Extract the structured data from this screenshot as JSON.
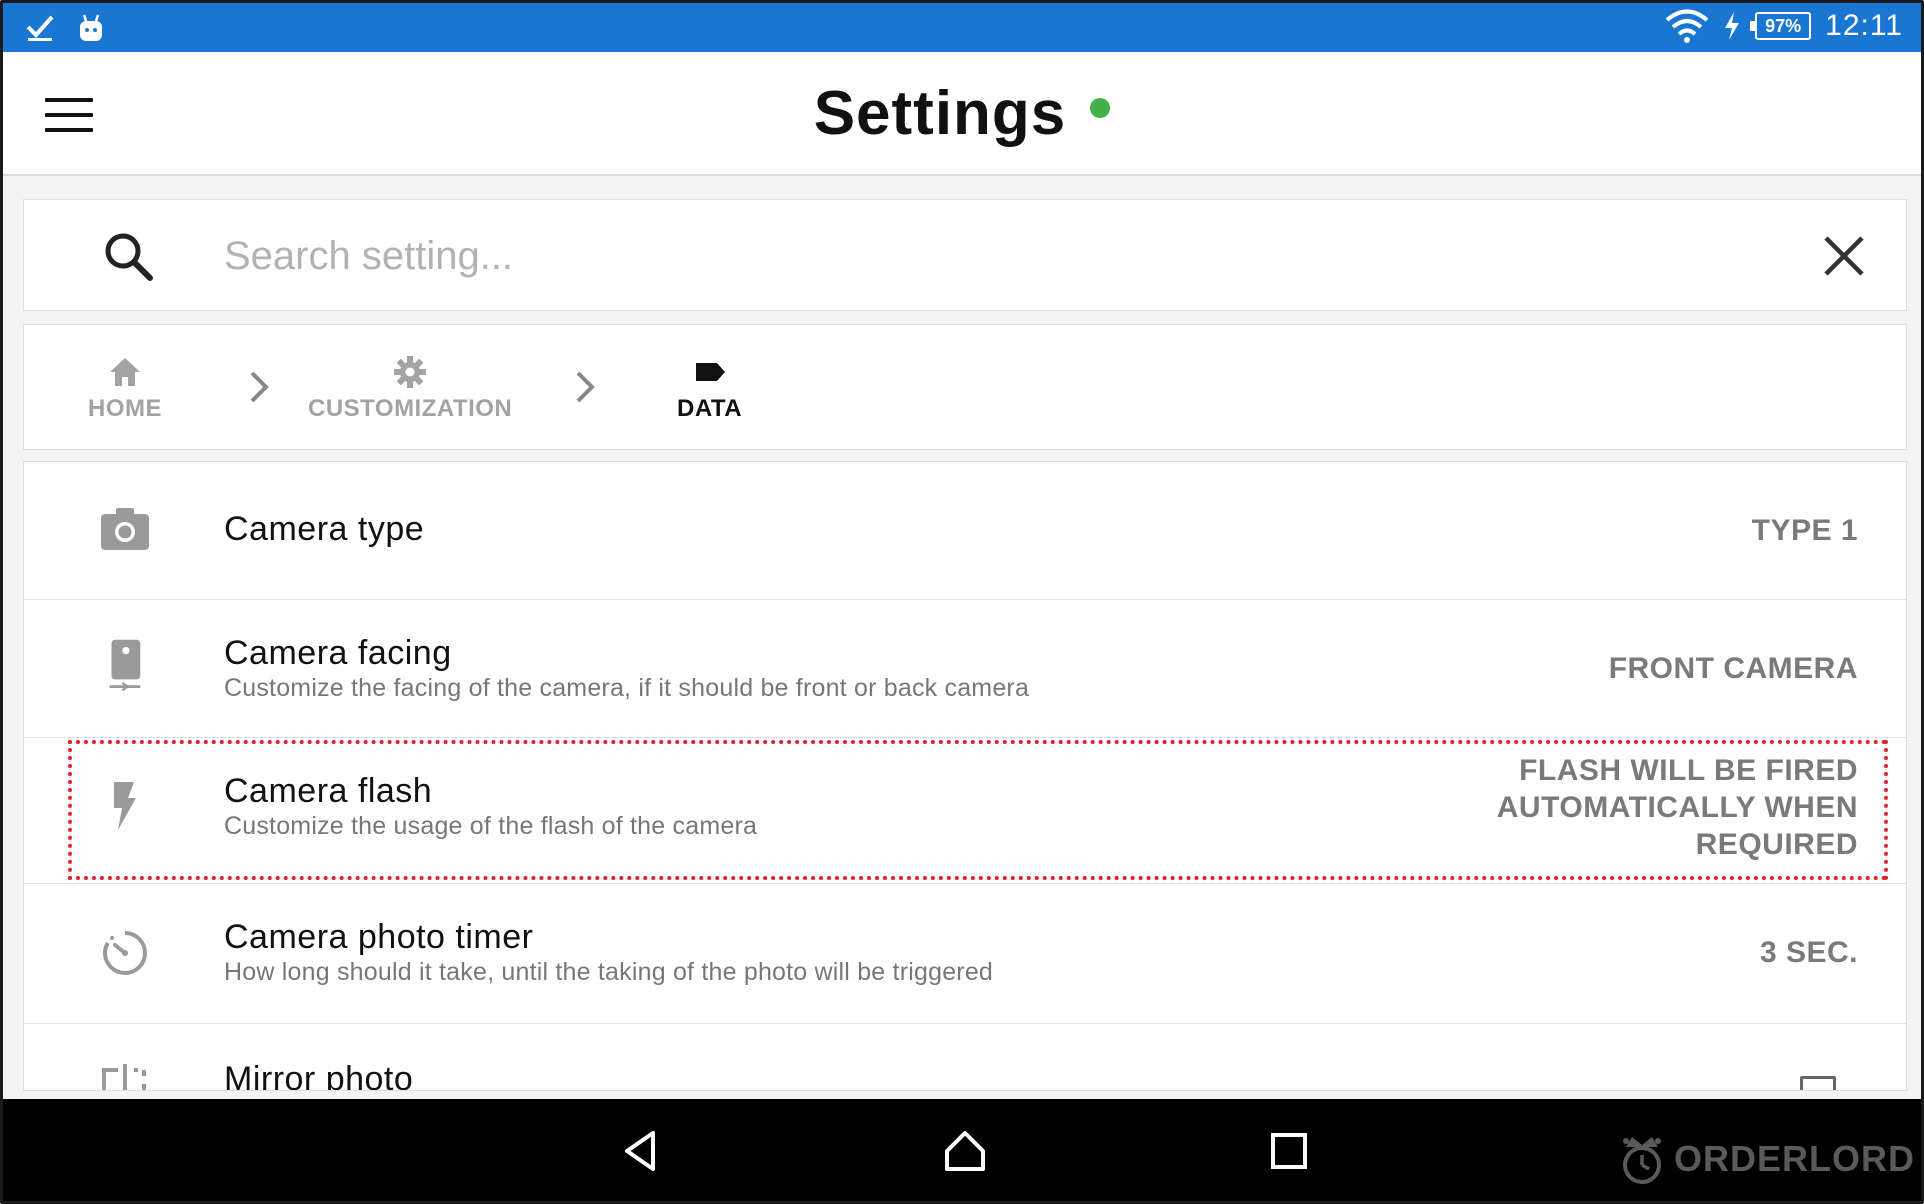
{
  "status_bar": {
    "battery": "97%",
    "time": "12:11"
  },
  "app_bar": {
    "title": "Settings",
    "status_dot_color": "#43b04a"
  },
  "search": {
    "placeholder": "Search setting...",
    "value": ""
  },
  "breadcrumb": {
    "items": [
      {
        "label": "HOME",
        "icon": "home-icon"
      },
      {
        "label": "CUSTOMIZATION",
        "icon": "gear-icon"
      },
      {
        "label": "DATA",
        "icon": "label-icon"
      }
    ]
  },
  "settings": [
    {
      "icon": "camera-icon",
      "title": "Camera type",
      "subtitle": "",
      "value": "TYPE 1"
    },
    {
      "icon": "camera-facing-icon",
      "title": "Camera facing",
      "subtitle": "Customize the facing of the camera, if it should be front or back camera",
      "value": "FRONT CAMERA"
    },
    {
      "icon": "flash-icon",
      "title": "Camera flash",
      "subtitle": "Customize the usage of the flash of the camera",
      "value_lines": [
        "FLASH WILL BE FIRED",
        "AUTOMATICALLY WHEN",
        "REQUIRED"
      ]
    },
    {
      "icon": "timer-icon",
      "title": "Camera photo timer",
      "subtitle": "How long should it take, until the taking of the photo will be triggered",
      "value": "3 SEC."
    },
    {
      "icon": "mirror-icon",
      "title": "Mirror photo",
      "subtitle": "",
      "value": ""
    }
  ],
  "watermark": "ORDERLORD",
  "colors": {
    "status_bar": "#1976d2",
    "highlight": "#e0212b",
    "accent_dot": "#43b04a"
  }
}
